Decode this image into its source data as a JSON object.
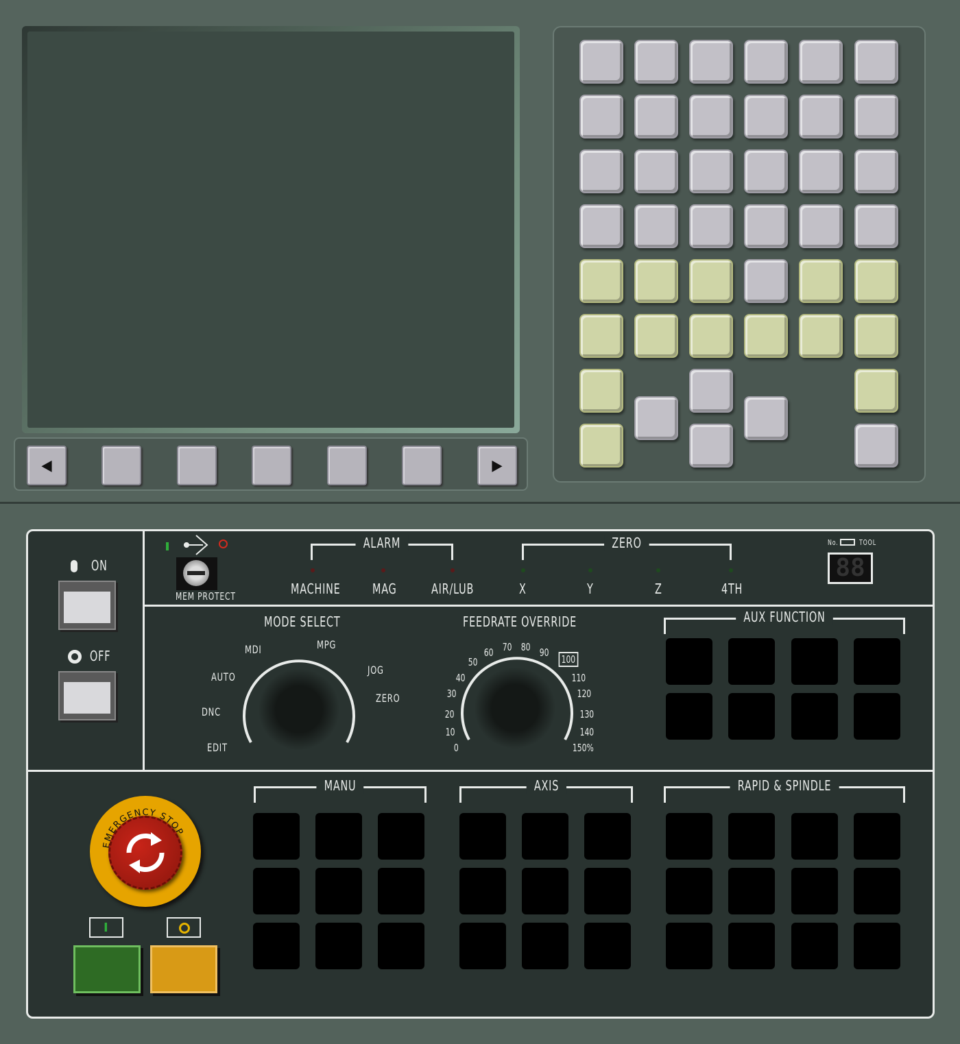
{
  "softkeys": {
    "prev_symbol": "◀",
    "next_symbol": "▶"
  },
  "keypad": {
    "rows": [
      [
        "gray",
        "gray",
        "gray",
        "gray",
        "gray",
        "gray"
      ],
      [
        "gray",
        "gray",
        "gray",
        "gray",
        "gray",
        "gray"
      ],
      [
        "gray",
        "gray",
        "gray",
        "gray",
        "gray",
        "gray"
      ],
      [
        "gray",
        "gray",
        "gray",
        "gray",
        "gray",
        "gray"
      ],
      [
        "yellow",
        "yellow",
        "yellow",
        "gray",
        "yellow",
        "yellow"
      ],
      [
        "yellow",
        "yellow",
        "yellow",
        "yellow",
        "yellow",
        "yellow"
      ]
    ]
  },
  "power": {
    "on_label": "ON",
    "off_label": "OFF"
  },
  "mem_protect": {
    "label": "MEM PROTECT"
  },
  "alarm": {
    "title": "ALARM",
    "items": [
      "MACHINE",
      "MAG",
      "AIR/LUB"
    ]
  },
  "zero": {
    "title": "ZERO",
    "items": [
      "X",
      "Y",
      "Z",
      "4TH"
    ]
  },
  "tool_display": {
    "no_label": "No.",
    "tool_label": "TOOL",
    "value": "88"
  },
  "mode_select": {
    "title": "MODE SELECT",
    "positions": [
      "EDIT",
      "DNC",
      "AUTO",
      "MDI",
      "MPG",
      "JOG",
      "ZERO"
    ]
  },
  "feedrate": {
    "title": "FEEDRATE OVERRIDE",
    "ticks": [
      "0",
      "10",
      "20",
      "30",
      "40",
      "50",
      "60",
      "70",
      "80",
      "90",
      "100",
      "110",
      "120",
      "130",
      "140",
      "150%"
    ]
  },
  "aux": {
    "title": "AUX FUNCTION"
  },
  "groups": {
    "manu": "MANU",
    "axis": "AXIS",
    "rapid": "RAPID & SPINDLE"
  },
  "estop": {
    "label": "EMERGENCY STOP"
  },
  "cycle": {
    "start_symbol": "I",
    "stop_symbol": "O"
  },
  "colors": {
    "panel": "#293330",
    "bezel": "#55645d",
    "yellow_key": "#cfd5a7",
    "gray_key": "#c2c0c7",
    "estop_ring": "#e6a400",
    "estop_red": "#a31a10",
    "start_green": "#2e6b24",
    "stop_amber": "#d89a16"
  }
}
